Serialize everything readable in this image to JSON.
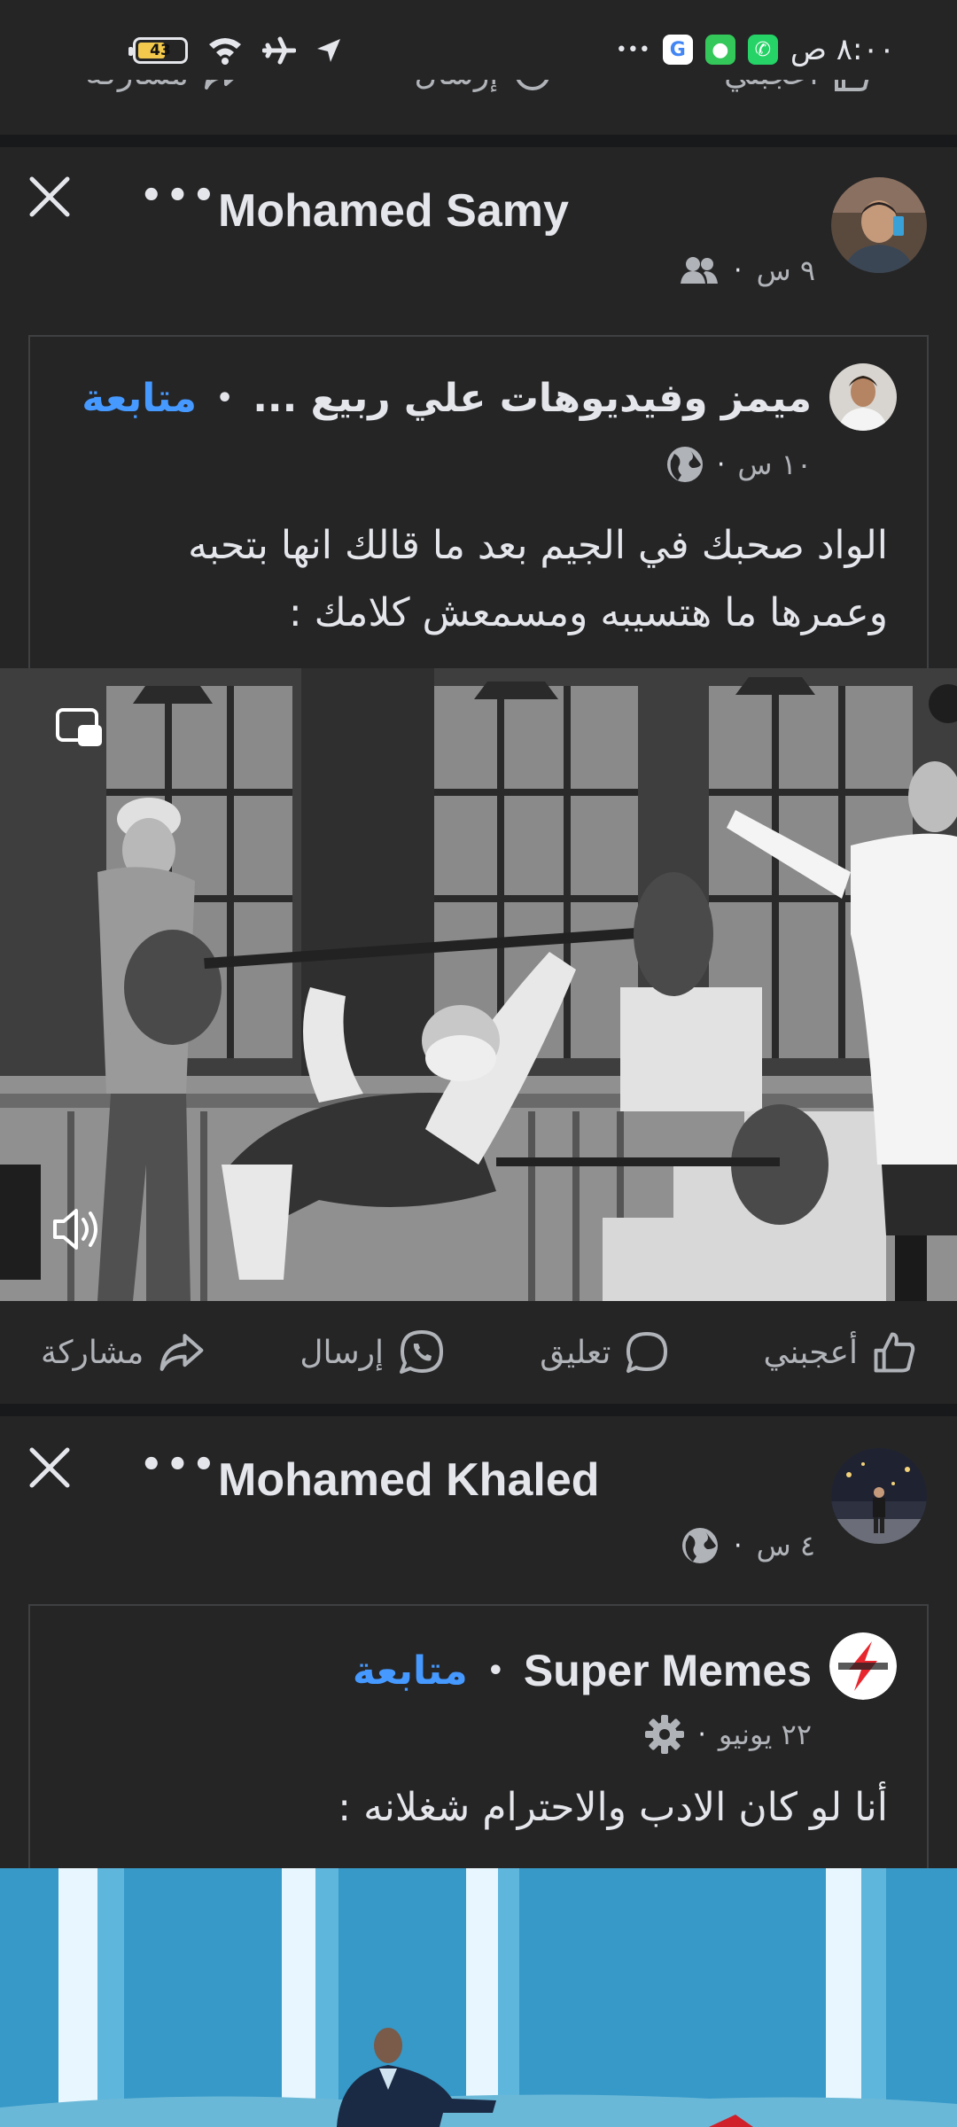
{
  "status_bar": {
    "time": "٨:٠٠ ص",
    "battery_level": "43",
    "overflow": "•••",
    "icons": [
      "google-icon",
      "messages-icon",
      "whatsapp-icon",
      "wifi-icon",
      "airplane-icon",
      "location-icon"
    ]
  },
  "top_actions": {
    "like": "أعجبني",
    "send": "إرسال",
    "share": "مشاركة"
  },
  "posts": [
    {
      "author": "Mohamed Samy",
      "time": "٩ س",
      "audience_icon": "friends-icon",
      "more": "•••",
      "shared": {
        "source": "ميمز وفيديوهات علي ربيع ...",
        "follow": "متابعة",
        "dot": "•",
        "time": "١٠ س",
        "audience_icon": "globe-icon",
        "caption_line1": "الواد صحبك في الجيم بعد ما قالك انها بتحبه",
        "caption_line2": "وعمرها ما هتسيبه ومسمعش كلامك :"
      },
      "actions": {
        "like": "أعجبني",
        "comment": "تعليق",
        "send": "إرسال",
        "share": "مشاركة"
      }
    },
    {
      "author": "Mohamed Khaled",
      "time": "٤ س",
      "audience_icon": "globe-icon",
      "more": "•••",
      "shared": {
        "source": "Super Memes",
        "follow": "متابعة",
        "dot": "•",
        "time": "٢٢ يونيو",
        "audience_icon": "gear-icon",
        "caption_line1": "أنا لو كان الادب والاحترام شغلانه :"
      }
    }
  ],
  "colors": {
    "background": "#252526",
    "divider": "#18191a",
    "accent": "#4599ff",
    "muted": "#b0b3b8"
  }
}
